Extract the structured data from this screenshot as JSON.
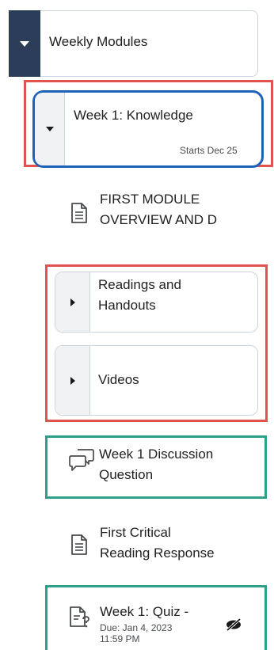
{
  "module": {
    "title": "Weekly Modules",
    "expanded": true
  },
  "week": {
    "title": "Week 1: Knowledge",
    "starts": "Starts Dec 25",
    "expanded": true
  },
  "items": {
    "overview": {
      "line1": "FIRST MODULE",
      "line2": "OVERVIEW AND D",
      "icon": "document-icon"
    },
    "readings": {
      "line1": "Readings and",
      "line2": "Handouts",
      "icon": "chevron-right-icon"
    },
    "videos": {
      "label": "Videos",
      "icon": "chevron-right-icon"
    },
    "discussion": {
      "line1": "Week 1 Discussion",
      "line2": "Question",
      "icon": "discussion-icon"
    },
    "critical": {
      "line1": "First Critical",
      "line2": "Reading Response",
      "icon": "document-icon"
    },
    "quiz": {
      "line1": "Week 1: Quiz -",
      "due_line1": "Due: Jan 4, 2023",
      "due_line2": "11:59 PM",
      "icon": "quiz-icon",
      "status_icon": "hidden-eye-icon"
    }
  },
  "colors": {
    "header_toggle": "#2b3d59",
    "highlight_red": "#e0534f",
    "highlight_blue": "#1d62b8",
    "highlight_green": "#2e9f89"
  }
}
